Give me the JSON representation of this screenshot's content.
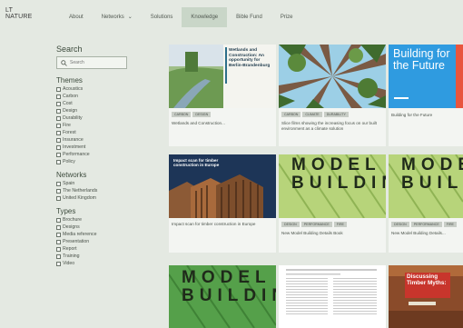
{
  "logo": {
    "line1": "LT",
    "line2": "NATURE"
  },
  "nav": {
    "items": [
      {
        "label": "About"
      },
      {
        "label": "Networks"
      },
      {
        "label": "Solutions"
      },
      {
        "label": "Knowledge"
      },
      {
        "label": "Bible Fund"
      },
      {
        "label": "Prize"
      }
    ],
    "active": "Knowledge"
  },
  "sidebar": {
    "search_heading": "Search",
    "search_placeholder": "Search",
    "themes_heading": "Themes",
    "themes": [
      "Acoustics",
      "Carbon",
      "Cost",
      "Design",
      "Durability",
      "Fire",
      "Forest",
      "Insurance",
      "Investment",
      "Performance",
      "Policy"
    ],
    "networks_heading": "Networks",
    "networks": [
      "Spain",
      "The Netherlands",
      "United Kingdom"
    ],
    "types_heading": "Types",
    "types": [
      "Brochure",
      "Designs",
      "Media reference",
      "Presentation",
      "Report",
      "Training",
      "Video"
    ]
  },
  "cards": [
    {
      "img_title": "Wetlands and Construction: An opportunity for Berlin-Brandenburg",
      "tags": [
        "CARBON",
        "DESIGN"
      ],
      "title": "Wetlands and Construction..."
    },
    {
      "img_title": "",
      "tags": [
        "CARBON",
        "CLIMATE",
        "DURABILITY"
      ],
      "title": "Slice films showing the increasing focus on our built environment as a climate solution"
    },
    {
      "img_title": "Building for the Future",
      "tags": [],
      "title": "Building for the Future"
    },
    {
      "img_title": "Impact scan for timber construction in Europe",
      "tags": [],
      "title": "Impact scan for timber construction in Europe"
    },
    {
      "img_title": "MODEL BUILDING",
      "tags": [
        "DESIGN",
        "PERFORMANCE",
        "FIRE"
      ],
      "title": "New Model Building Details Book"
    },
    {
      "img_title": "MODEL BUILDING",
      "tags": [
        "DESIGN",
        "PERFORMANCE",
        "FIRE"
      ],
      "title": "New Model Building Details..."
    },
    {
      "img_title": "MODEL BUILDING",
      "tags": [],
      "title": ""
    },
    {
      "img_title": "",
      "tags": [],
      "title": ""
    },
    {
      "img_title": "Discussing Timber Myths:",
      "tags": [],
      "title": ""
    }
  ]
}
